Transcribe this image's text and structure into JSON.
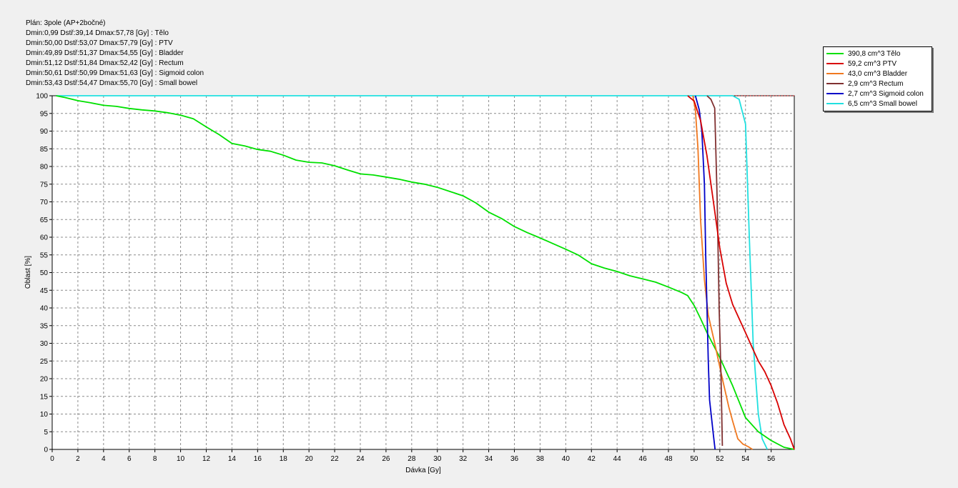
{
  "header": {
    "plan": "Plán: 3pole (AP+2bočné)",
    "lines": [
      "Dmin:0,99 Dstř:39,14 Dmax:57,78 [Gy] : Tělo",
      "Dmin:50,00 Dstř:53,07 Dmax:57,79 [Gy] : PTV",
      "Dmin:49,89 Dstř:51,37 Dmax:54,55 [Gy] : Bladder",
      "Dmin:51,12 Dstř:51,84 Dmax:52,42 [Gy] : Rectum",
      "Dmin:50,61 Dstř:50,99 Dmax:51,63 [Gy] : Sigmoid colon",
      "Dmin:53,43 Dstř:54,47 Dmax:55,70 [Gy] : Small bowel"
    ]
  },
  "chart_data": {
    "type": "line",
    "xlabel": "Dávka [Gy]",
    "ylabel": "Oblast [%]",
    "xlim": [
      0,
      57.8
    ],
    "ylim": [
      0,
      100
    ],
    "x_ticks": [
      0,
      2,
      4,
      6,
      8,
      10,
      12,
      14,
      16,
      18,
      20,
      22,
      24,
      26,
      28,
      30,
      32,
      34,
      36,
      38,
      40,
      42,
      44,
      46,
      48,
      50,
      52,
      54,
      56
    ],
    "y_ticks": [
      0,
      5,
      10,
      15,
      20,
      25,
      30,
      35,
      40,
      45,
      50,
      55,
      60,
      65,
      70,
      75,
      80,
      85,
      90,
      95,
      100
    ],
    "grid": true,
    "legend_position": "outside-top-right",
    "reference_line": {
      "y": 100,
      "x_from": 53.0,
      "color": "#c00000"
    },
    "series": [
      {
        "name": "390,8 cm^3 Tělo",
        "color": "#00e000",
        "x": [
          0.3,
          1,
          2,
          3,
          4,
          5,
          6,
          7,
          8,
          9,
          10,
          11,
          12,
          13,
          14,
          15,
          16,
          17,
          18,
          19,
          20,
          21,
          22,
          23,
          24,
          25,
          26,
          27,
          28,
          29,
          30,
          31,
          32,
          33,
          34,
          35,
          36,
          37,
          38,
          39,
          40,
          41,
          42,
          43,
          44,
          45,
          46,
          47,
          48,
          49,
          49.5,
          50,
          50.5,
          51,
          52,
          53,
          54,
          55,
          56,
          57,
          57.8
        ],
        "y": [
          100,
          99.5,
          98.6,
          98,
          97.3,
          97,
          96.4,
          96,
          95.7,
          95.2,
          94.5,
          93.5,
          91.2,
          89,
          86.5,
          85.8,
          84.8,
          84.3,
          83.2,
          81.8,
          81.2,
          81,
          80.2,
          79,
          77.9,
          77.6,
          77,
          76.4,
          75.6,
          75,
          74.1,
          72.9,
          71.7,
          69.7,
          67.1,
          65.3,
          63,
          61.3,
          59.8,
          58.2,
          56.6,
          54.9,
          52.5,
          51.3,
          50.3,
          49.1,
          48.2,
          47.3,
          45.9,
          44.4,
          43.5,
          40.7,
          37,
          33,
          26,
          18,
          9,
          5,
          2.5,
          0.6,
          0
        ]
      },
      {
        "name": "59,2 cm^3 PTV",
        "color": "#d80000",
        "x": [
          49.5,
          50,
          50.5,
          51,
          51.5,
          52,
          52.5,
          53,
          53.5,
          54,
          54.5,
          55,
          55.5,
          56,
          56.5,
          57,
          57.5,
          57.8
        ],
        "y": [
          100,
          98.5,
          93,
          83,
          70,
          57,
          47,
          41,
          37,
          33,
          29,
          25,
          22,
          18,
          13,
          7,
          3,
          0
        ]
      },
      {
        "name": "43,0 cm^3 Bladder",
        "color": "#f07820",
        "x": [
          49.9,
          50.1,
          50.3,
          50.5,
          50.8,
          51.1,
          51.6,
          52.2,
          52.7,
          53,
          53.4,
          53.8,
          54.2,
          54.55
        ],
        "y": [
          100,
          96,
          85,
          65,
          48,
          38,
          30,
          20,
          12,
          8,
          3,
          1.5,
          0.8,
          0
        ]
      },
      {
        "name": "2,9 cm^3 Rectum",
        "color": "#803030",
        "x": [
          51.0,
          51.3,
          51.6,
          51.8,
          51.95,
          52.1,
          52.2
        ],
        "y": [
          100,
          99,
          96.5,
          70,
          40,
          20,
          1
        ]
      },
      {
        "name": "2,7 cm^3 Sigmoid colon",
        "color": "#0000c8",
        "x": [
          50.1,
          50.4,
          50.6,
          50.8,
          50.9,
          51.0,
          51.1,
          51.2,
          51.5,
          51.63
        ],
        "y": [
          100,
          96,
          90,
          75,
          55,
          40,
          25,
          14,
          4,
          0
        ]
      },
      {
        "name": "6,5 cm^3 Small bowel",
        "color": "#20e0e0",
        "x": [
          0.3,
          10,
          20,
          30,
          40,
          50,
          53.0,
          53.5,
          54.0,
          54.3,
          54.6,
          55.0,
          55.3,
          55.7
        ],
        "y": [
          100,
          100,
          100,
          100,
          100,
          100,
          100,
          99,
          92,
          60,
          30,
          10,
          3,
          0
        ]
      }
    ]
  }
}
